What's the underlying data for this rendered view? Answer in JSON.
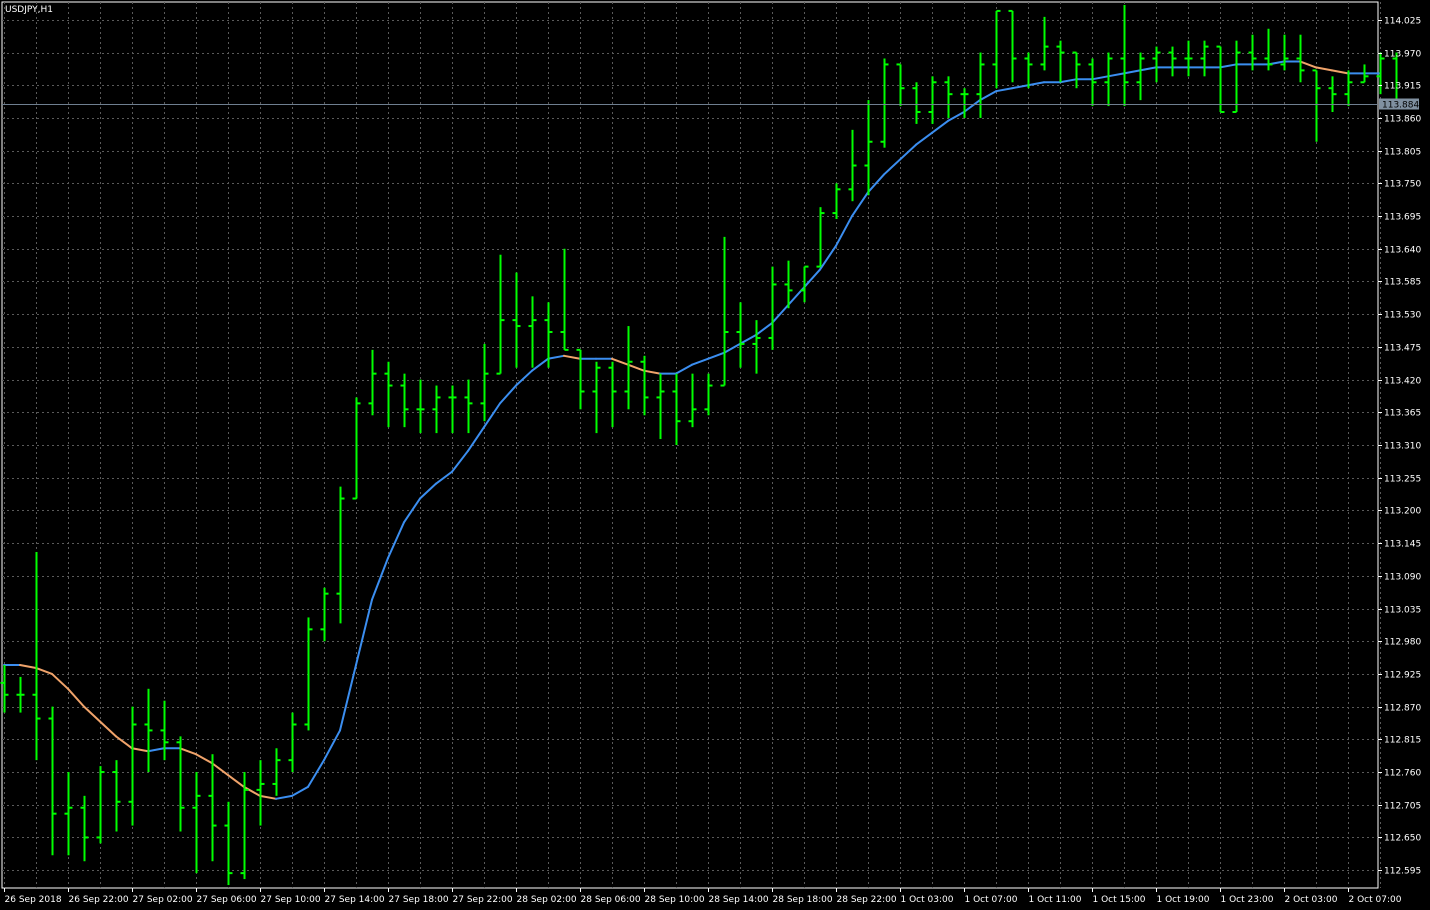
{
  "chart_title": "USDJPY,H1",
  "colors": {
    "background": "#000000",
    "grid": "#5a5a5a",
    "axis": "#ffffff",
    "bars": "#00ff00",
    "ma_up": "#3b8ef0",
    "ma_down": "#f0a36a",
    "current_price_line": "#6f7f90",
    "current_price_label_bg": "#8090a0"
  },
  "chart_data": {
    "type": "ohlc",
    "title": "USDJPY,H1",
    "timeframe": "H1",
    "ylim": [
      112.565,
      114.055
    ],
    "current_price": 113.884,
    "current_price_label": "113.884",
    "y_ticks": [
      "114.025",
      "113.970",
      "113.915",
      "113.860",
      "113.805",
      "113.750",
      "113.695",
      "113.640",
      "113.585",
      "113.530",
      "113.475",
      "113.420",
      "113.365",
      "113.310",
      "113.255",
      "113.200",
      "113.145",
      "113.090",
      "113.035",
      "112.980",
      "112.925",
      "112.870",
      "112.815",
      "112.760",
      "112.705",
      "112.650",
      "112.595"
    ],
    "x_ticks": [
      {
        "label": "26 Sep 2018",
        "index": 0
      },
      {
        "label": "26 Sep 22:00",
        "index": 4
      },
      {
        "label": "27 Sep 02:00",
        "index": 8
      },
      {
        "label": "27 Sep 06:00",
        "index": 12
      },
      {
        "label": "27 Sep 10:00",
        "index": 16
      },
      {
        "label": "27 Sep 14:00",
        "index": 20
      },
      {
        "label": "27 Sep 18:00",
        "index": 24
      },
      {
        "label": "27 Sep 22:00",
        "index": 28
      },
      {
        "label": "28 Sep 02:00",
        "index": 32
      },
      {
        "label": "28 Sep 06:00",
        "index": 36
      },
      {
        "label": "28 Sep 10:00",
        "index": 40
      },
      {
        "label": "28 Sep 14:00",
        "index": 44
      },
      {
        "label": "28 Sep 18:00",
        "index": 48
      },
      {
        "label": "28 Sep 22:00",
        "index": 52
      },
      {
        "label": "1 Oct 03:00",
        "index": 56
      },
      {
        "label": "1 Oct 07:00",
        "index": 60
      },
      {
        "label": "1 Oct 11:00",
        "index": 64
      },
      {
        "label": "1 Oct 15:00",
        "index": 68
      },
      {
        "label": "1 Oct 19:00",
        "index": 72
      },
      {
        "label": "1 Oct 23:00",
        "index": 76
      },
      {
        "label": "2 Oct 03:00",
        "index": 80
      },
      {
        "label": "2 Oct 07:00",
        "index": 84
      }
    ],
    "ohlc": [
      [
        112.91,
        112.94,
        112.86,
        112.89
      ],
      [
        112.89,
        112.92,
        112.86,
        112.89
      ],
      [
        112.89,
        113.13,
        112.78,
        112.85
      ],
      [
        112.85,
        112.87,
        112.62,
        112.69
      ],
      [
        112.69,
        112.76,
        112.62,
        112.7
      ],
      [
        112.7,
        112.72,
        112.61,
        112.65
      ],
      [
        112.65,
        112.77,
        112.64,
        112.76
      ],
      [
        112.76,
        112.78,
        112.66,
        112.71
      ],
      [
        112.71,
        112.87,
        112.67,
        112.84
      ],
      [
        112.84,
        112.9,
        112.76,
        112.83
      ],
      [
        112.83,
        112.88,
        112.78,
        112.81
      ],
      [
        112.81,
        112.82,
        112.66,
        112.7
      ],
      [
        112.7,
        112.76,
        112.59,
        112.72
      ],
      [
        112.72,
        112.79,
        112.61,
        112.67
      ],
      [
        112.67,
        112.71,
        112.57,
        112.59
      ],
      [
        112.59,
        112.76,
        112.58,
        112.73
      ],
      [
        112.73,
        112.78,
        112.67,
        112.74
      ],
      [
        112.74,
        112.8,
        112.72,
        112.78
      ],
      [
        112.78,
        112.86,
        112.76,
        112.84
      ],
      [
        112.84,
        113.02,
        112.83,
        113.0
      ],
      [
        113.0,
        113.07,
        112.98,
        113.06
      ],
      [
        113.06,
        113.24,
        113.01,
        113.22
      ],
      [
        113.22,
        113.39,
        113.22,
        113.38
      ],
      [
        113.38,
        113.47,
        113.36,
        113.43
      ],
      [
        113.43,
        113.45,
        113.34,
        113.41
      ],
      [
        113.41,
        113.43,
        113.34,
        113.37
      ],
      [
        113.37,
        113.42,
        113.33,
        113.37
      ],
      [
        113.37,
        113.41,
        113.33,
        113.39
      ],
      [
        113.39,
        113.41,
        113.33,
        113.39
      ],
      [
        113.39,
        113.42,
        113.33,
        113.38
      ],
      [
        113.38,
        113.48,
        113.35,
        113.43
      ],
      [
        113.43,
        113.63,
        113.43,
        113.52
      ],
      [
        113.52,
        113.6,
        113.44,
        113.51
      ],
      [
        113.51,
        113.56,
        113.44,
        113.52
      ],
      [
        113.52,
        113.55,
        113.44,
        113.5
      ],
      [
        113.5,
        113.64,
        113.47,
        113.47
      ],
      [
        113.47,
        113.47,
        113.37,
        113.4
      ],
      [
        113.4,
        113.45,
        113.33,
        113.44
      ],
      [
        113.44,
        113.45,
        113.34,
        113.4
      ],
      [
        113.4,
        113.51,
        113.37,
        113.45
      ],
      [
        113.45,
        113.46,
        113.36,
        113.39
      ],
      [
        113.39,
        113.43,
        113.32,
        113.4
      ],
      [
        113.4,
        113.43,
        113.31,
        113.35
      ],
      [
        113.35,
        113.43,
        113.34,
        113.37
      ],
      [
        113.37,
        113.43,
        113.36,
        113.41
      ],
      [
        113.41,
        113.66,
        113.41,
        113.5
      ],
      [
        113.5,
        113.55,
        113.44,
        113.48
      ],
      [
        113.48,
        113.52,
        113.43,
        113.49
      ],
      [
        113.49,
        113.61,
        113.47,
        113.58
      ],
      [
        113.58,
        113.62,
        113.54,
        113.57
      ],
      [
        113.57,
        113.61,
        113.55,
        113.61
      ],
      [
        113.61,
        113.71,
        113.61,
        113.7
      ],
      [
        113.7,
        113.75,
        113.69,
        113.74
      ],
      [
        113.74,
        113.84,
        113.72,
        113.78
      ],
      [
        113.78,
        113.89,
        113.73,
        113.82
      ],
      [
        113.82,
        113.96,
        113.81,
        113.95
      ],
      [
        113.95,
        113.95,
        113.88,
        113.91
      ],
      [
        113.91,
        113.92,
        113.85,
        113.87
      ],
      [
        113.87,
        113.93,
        113.85,
        113.92
      ],
      [
        113.92,
        113.93,
        113.86,
        113.9
      ],
      [
        113.9,
        113.91,
        113.86,
        113.9
      ],
      [
        113.9,
        113.97,
        113.86,
        113.95
      ],
      [
        113.95,
        114.04,
        113.91,
        114.04
      ],
      [
        114.04,
        114.04,
        113.92,
        113.96
      ],
      [
        113.96,
        113.97,
        113.91,
        113.95
      ],
      [
        113.95,
        114.03,
        113.94,
        113.98
      ],
      [
        113.98,
        113.99,
        113.92,
        113.97
      ],
      [
        113.97,
        113.97,
        113.91,
        113.95
      ],
      [
        113.95,
        113.96,
        113.88,
        113.92
      ],
      [
        113.92,
        113.97,
        113.88,
        113.96
      ],
      [
        113.96,
        114.05,
        113.88,
        113.92
      ],
      [
        113.92,
        113.97,
        113.89,
        113.96
      ],
      [
        113.96,
        113.98,
        113.92,
        113.97
      ],
      [
        113.97,
        113.98,
        113.93,
        113.96
      ],
      [
        113.96,
        113.99,
        113.93,
        113.96
      ],
      [
        113.96,
        113.99,
        113.93,
        113.98
      ],
      [
        113.98,
        113.98,
        113.87,
        113.87
      ],
      [
        113.87,
        113.99,
        113.87,
        113.97
      ],
      [
        113.97,
        114.0,
        113.94,
        113.96
      ],
      [
        113.96,
        114.01,
        113.94,
        113.95
      ],
      [
        113.95,
        114.0,
        113.94,
        113.96
      ],
      [
        113.96,
        114.0,
        113.92,
        113.94
      ],
      [
        113.94,
        113.94,
        113.82,
        113.91
      ],
      [
        113.91,
        113.93,
        113.87,
        113.9
      ],
      [
        113.9,
        113.94,
        113.88,
        113.92
      ],
      [
        113.92,
        113.95,
        113.92,
        113.93
      ],
      [
        113.93,
        113.97,
        113.9,
        113.96
      ],
      [
        113.96,
        113.97,
        113.88,
        113.89
      ]
    ],
    "moving_average": [
      112.94,
      112.94,
      112.935,
      112.925,
      112.9,
      112.87,
      112.845,
      112.82,
      112.8,
      112.795,
      112.8,
      112.8,
      112.79,
      112.775,
      112.755,
      112.735,
      112.72,
      112.715,
      112.72,
      112.735,
      112.78,
      112.83,
      112.94,
      113.05,
      113.12,
      113.18,
      113.22,
      113.245,
      113.265,
      113.3,
      113.34,
      113.38,
      113.41,
      113.435,
      113.455,
      113.46,
      113.455,
      113.455,
      113.455,
      113.445,
      113.435,
      113.43,
      113.43,
      113.445,
      113.455,
      113.465,
      113.48,
      113.495,
      113.515,
      113.545,
      113.575,
      113.605,
      113.645,
      113.695,
      113.735,
      113.765,
      113.79,
      113.815,
      113.835,
      113.855,
      113.87,
      113.89,
      113.905,
      113.91,
      113.915,
      113.92,
      113.92,
      113.925,
      113.925,
      113.93,
      113.935,
      113.94,
      113.945,
      113.945,
      113.945,
      113.945,
      113.945,
      113.95,
      113.95,
      113.95,
      113.955,
      113.955,
      113.945,
      113.94,
      113.935,
      113.935,
      113.935
    ],
    "ma_color_rule": "blue when rising, orange when falling"
  }
}
